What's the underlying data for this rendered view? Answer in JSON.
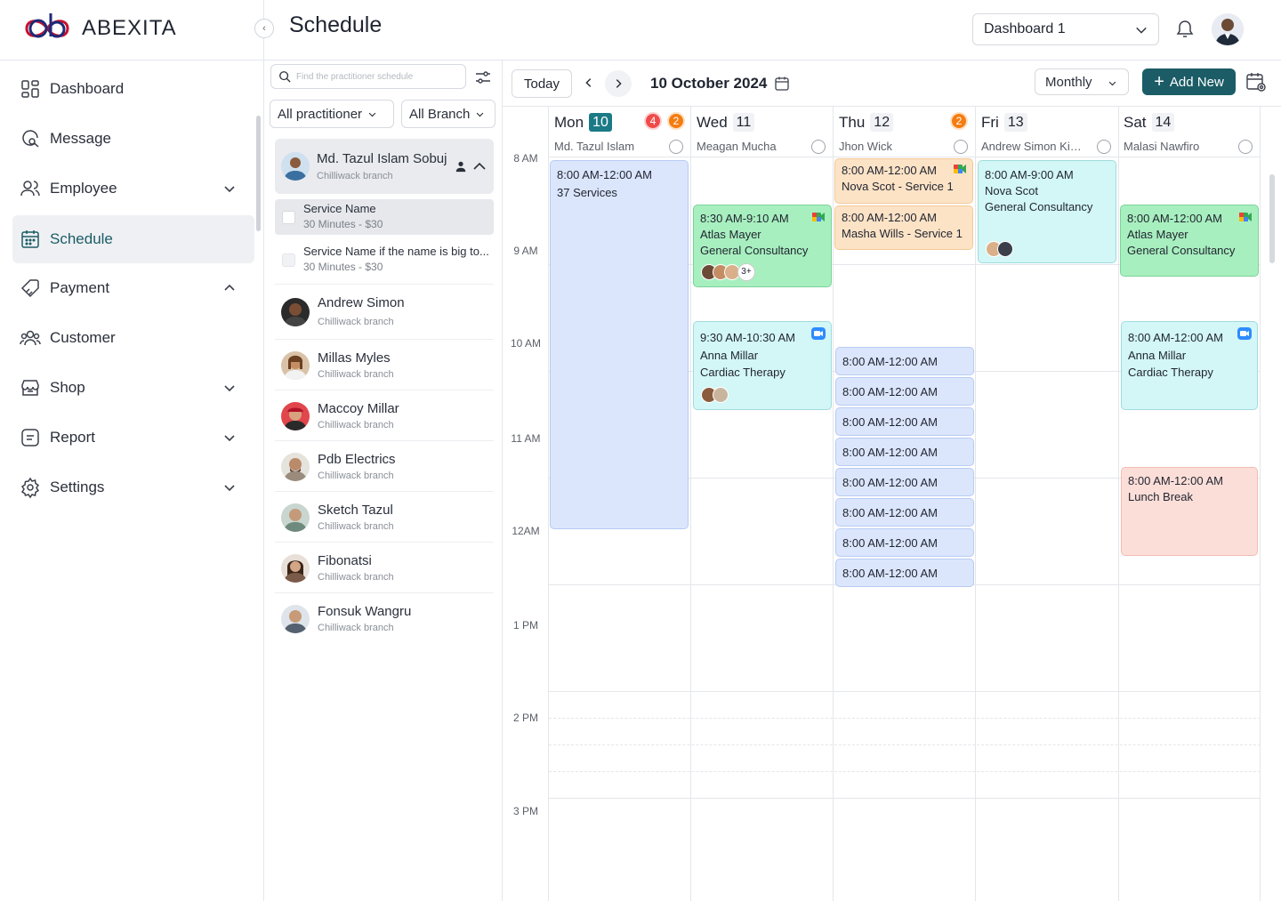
{
  "brand": {
    "name": "ABEXITA"
  },
  "header": {
    "title": "Schedule",
    "dashboard_select": "Dashboard 1"
  },
  "sidebar": {
    "items": [
      {
        "label": "Dashboard"
      },
      {
        "label": "Message"
      },
      {
        "label": "Employee"
      },
      {
        "label": "Schedule"
      },
      {
        "label": "Payment"
      },
      {
        "label": "Customer"
      },
      {
        "label": "Shop"
      },
      {
        "label": "Report"
      },
      {
        "label": "Settings"
      }
    ]
  },
  "panel": {
    "search_placeholder": "Find the practitioner schedule",
    "filter_practitioner": "All practitioner",
    "filter_branch": "All Branch",
    "active": {
      "name": "Md. Tazul Islam Sobuj",
      "branch": "Chilliwack branch"
    },
    "services": [
      {
        "name": "Service Name",
        "price": "30 Minutes - $30"
      },
      {
        "name": "Service Name if the name is big to...",
        "price": "30 Minutes - $30"
      }
    ],
    "practitioners": [
      {
        "name": "Andrew Simon",
        "branch": "Chilliwack branch"
      },
      {
        "name": "Millas Myles",
        "branch": "Chilliwack branch"
      },
      {
        "name": "Maccoy Millar",
        "branch": "Chilliwack branch"
      },
      {
        "name": "Pdb Electrics",
        "branch": "Chilliwack branch"
      },
      {
        "name": "Sketch Tazul",
        "branch": "Chilliwack branch"
      },
      {
        "name": "Fibonatsi",
        "branch": "Chilliwack branch"
      },
      {
        "name": "Fonsuk Wangru",
        "branch": "Chilliwack branch"
      }
    ]
  },
  "toolbar": {
    "today": "Today",
    "date": "10 October 2024",
    "view": "Monthly",
    "add_new": "Add New"
  },
  "times": [
    "8 AM",
    "9 AM",
    "10 AM",
    "11 AM",
    "12AM",
    "1 PM",
    "2 PM",
    "3 PM"
  ],
  "days": [
    {
      "name": "Mon",
      "num": "10",
      "practitioner": "Md. Tazul Islam",
      "badge_red": "4",
      "badge_orange": "2"
    },
    {
      "name": "Wed",
      "num": "11",
      "practitioner": "Meagan Mucha"
    },
    {
      "name": "Thu",
      "num": "12",
      "practitioner": "Jhon Wick",
      "badge_orange": "2"
    },
    {
      "name": "Fri",
      "num": "13",
      "practitioner": "Andrew Simon Kis..."
    },
    {
      "name": "Sat",
      "num": "14",
      "practitioner": "Malasi Nawfiro"
    }
  ],
  "events": {
    "mon": {
      "time": "8:00 AM-12:00 AM",
      "detail": "37 Services"
    },
    "wed1": {
      "time": "8:30 AM-9:10 AM",
      "client": "Atlas Mayer",
      "service": "General Consultancy",
      "more": "3+"
    },
    "wed2": {
      "time": "9:30 AM-10:30 AM",
      "client": "Anna Millar",
      "service": "Cardiac Therapy"
    },
    "thu1": {
      "time": "8:00 AM-12:00 AM",
      "detail": "Nova Scot - Service 1"
    },
    "thu2": {
      "time": "8:00 AM-12:00 AM",
      "detail": "Masha Wills - Service 1"
    },
    "thu_mini": [
      "8:00 AM-12:00 AM",
      "8:00 AM-12:00 AM",
      "8:00 AM-12:00 AM",
      "8:00 AM-12:00 AM",
      "8:00 AM-12:00 AM",
      "8:00 AM-12:00 AM",
      "8:00 AM-12:00 AM",
      "8:00 AM-12:00 AM"
    ],
    "fri1": {
      "time": "8:00 AM-9:00 AM",
      "client": "Nova Scot",
      "service": "General Consultancy"
    },
    "sat1": {
      "time": "8:00 AM-12:00 AM",
      "client": "Atlas Mayer",
      "service": "General Consultancy"
    },
    "sat2": {
      "time": "8:00 AM-12:00 AM",
      "client": "Anna Millar",
      "service": "Cardiac Therapy"
    },
    "sat3": {
      "time": "8:00 AM-12:00 AM",
      "detail": "Lunch Break"
    }
  },
  "colors": {
    "accent": "#1b5c66",
    "today_badge": "#1b7a86",
    "badge_red": "#f04b4b",
    "badge_orange": "#f57c10"
  }
}
